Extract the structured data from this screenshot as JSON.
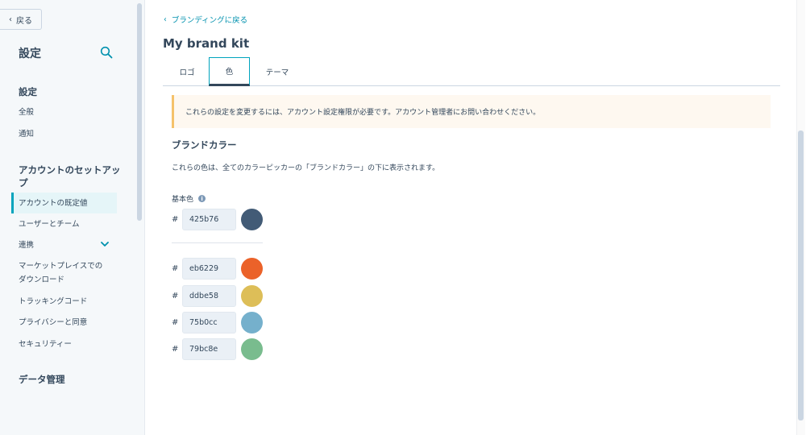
{
  "sidebar": {
    "back_label": "戻る",
    "title": "設定",
    "sections": [
      {
        "title": "設定",
        "items": [
          "全般",
          "通知"
        ]
      },
      {
        "title": "アカウントのセットアップ",
        "items": [
          "アカウントの既定値",
          "ユーザーとチーム",
          "連携",
          "マーケットプレイスでのダウンロード",
          "トラッキングコード",
          "プライバシーと同意",
          "セキュリティー"
        ]
      },
      {
        "title": "データ管理",
        "items": []
      }
    ],
    "active_item": "アカウントの既定値"
  },
  "main": {
    "breadcrumb": "ブランディングに戻る",
    "title": "My brand kit",
    "tabs": [
      {
        "label": "ロゴ",
        "active": false
      },
      {
        "label": "色",
        "active": true
      },
      {
        "label": "テーマ",
        "active": false
      }
    ],
    "alert": "これらの設定を変更するには、アカウント設定権限が必要です。アカウント管理者にお問い合わせください。",
    "brand_colors": {
      "heading": "ブランドカラー",
      "description": "これらの色は、全てのカラーピッカーの「ブランドカラー」の下に表示されます。",
      "primary_label": "基本色",
      "hash": "#",
      "primary": {
        "hex": "425b76",
        "color": "#425b76"
      },
      "others": [
        {
          "hex": "eb6229",
          "color": "#eb6229"
        },
        {
          "hex": "ddbe58",
          "color": "#ddbe58"
        },
        {
          "hex": "75b0cc",
          "color": "#75b0cc"
        },
        {
          "hex": "79bc8e",
          "color": "#79bc8e"
        }
      ]
    }
  },
  "colors": {
    "accent": "#00a4bd",
    "text": "#33475b",
    "link": "#0091ae"
  }
}
